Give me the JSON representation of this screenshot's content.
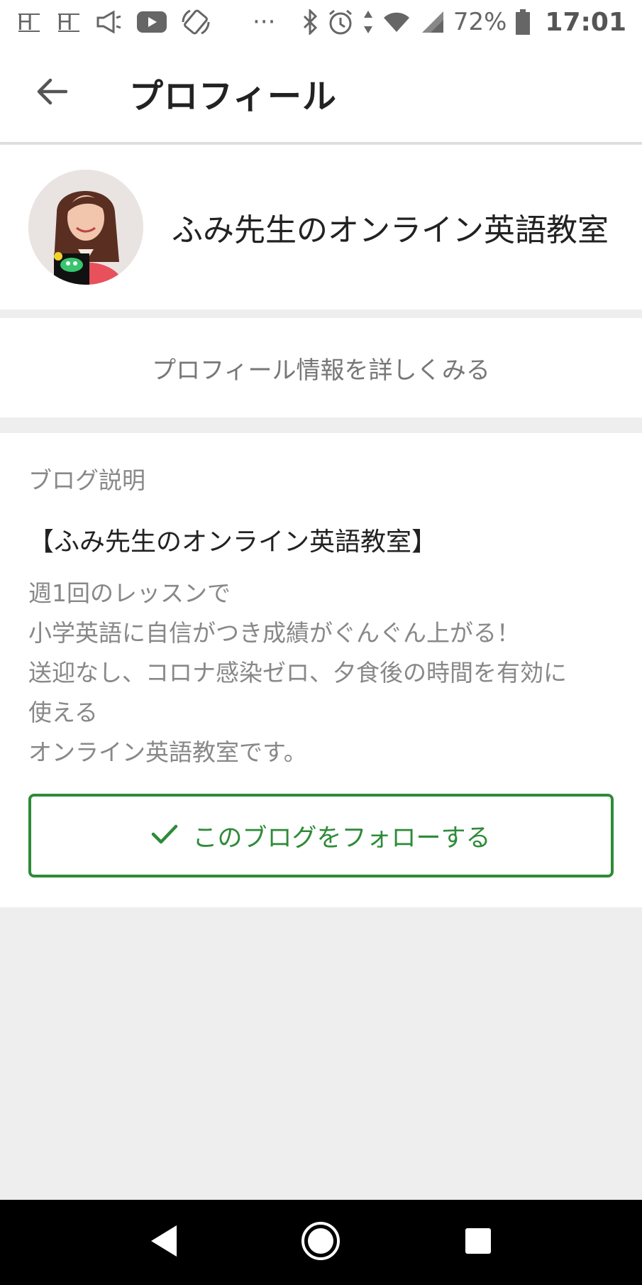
{
  "status_bar": {
    "battery_percent": "72%",
    "time": "17:01",
    "ellipsis": "···",
    "icons": [
      "hs-notification-icon",
      "hs-notification-icon",
      "megaphone-icon",
      "youtube-icon",
      "rotate-icon",
      "bluetooth-icon",
      "alarm-icon",
      "data-arrows-icon",
      "wifi-icon",
      "signal-icon",
      "battery-icon"
    ]
  },
  "app_bar": {
    "title": "プロフィール",
    "back_icon": "arrow-left-icon"
  },
  "profile": {
    "blog_name": "ふみ先生のオンライン英語教室",
    "view_details": "プロフィール情報を詳しくみる"
  },
  "description": {
    "heading": "ブログ説明",
    "title": "【ふみ先生のオンライン英語教室】",
    "lines": [
      "週1回のレッスンで",
      "小学英語に自信がつき成績がぐんぐん上がる！",
      "送迎なし、コロナ感染ゼロ、夕食後の時間を有効に",
      "使える",
      "オンライン英語教室です。"
    ]
  },
  "follow_button": {
    "label": "このブログをフォローする",
    "icon": "checkmark-icon"
  },
  "colors": {
    "accent_green": "#2e8b38",
    "background": "#eeeeee",
    "nav_bar": "#000000"
  },
  "nav": {
    "icons": [
      "back-triangle-icon",
      "home-circle-icon",
      "recents-square-icon"
    ]
  }
}
